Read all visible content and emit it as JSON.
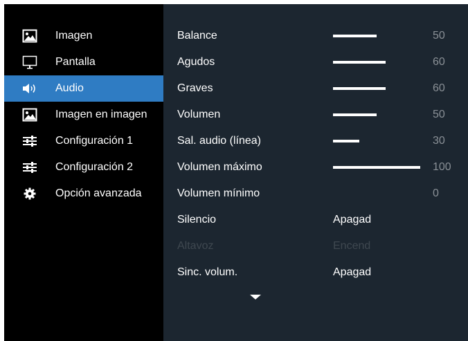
{
  "sidebar": {
    "items": [
      {
        "label": "Imagen",
        "icon": "image-icon",
        "active": false
      },
      {
        "label": "Pantalla",
        "icon": "monitor-icon",
        "active": false
      },
      {
        "label": "Audio",
        "icon": "speaker-icon",
        "active": true
      },
      {
        "label": "Imagen en imagen",
        "icon": "pip-icon",
        "active": false
      },
      {
        "label": "Configuración 1",
        "icon": "sliders-icon",
        "active": false
      },
      {
        "label": "Configuración 2",
        "icon": "sliders-icon",
        "active": false
      },
      {
        "label": "Opción avanzada",
        "icon": "gear-icon",
        "active": false
      }
    ]
  },
  "audio_settings": {
    "rows": [
      {
        "label": "Balance",
        "value": "50",
        "level": 50
      },
      {
        "label": "Agudos",
        "value": "60",
        "level": 60
      },
      {
        "label": "Graves",
        "value": "60",
        "level": 60
      },
      {
        "label": "Volumen",
        "value": "50",
        "level": 50
      },
      {
        "label": "Sal. audio (línea)",
        "value": "30",
        "level": 30
      },
      {
        "label": "Volumen máximo",
        "value": "100",
        "level": 100
      },
      {
        "label": "Volumen mínimo",
        "value": "0",
        "level": 0
      },
      {
        "label": "Silencio",
        "value": "Apagad"
      },
      {
        "label": "Altavoz",
        "value": "Encend",
        "disabled": true
      },
      {
        "label": "Sinc. volum.",
        "value": "Apagad"
      }
    ],
    "more_indicator": "chevron-down-icon"
  },
  "colors": {
    "active_highlight": "#2f7cc3",
    "panel_background": "#1c2630",
    "sidebar_background": "#000000",
    "disabled_text": "#3f4850"
  }
}
